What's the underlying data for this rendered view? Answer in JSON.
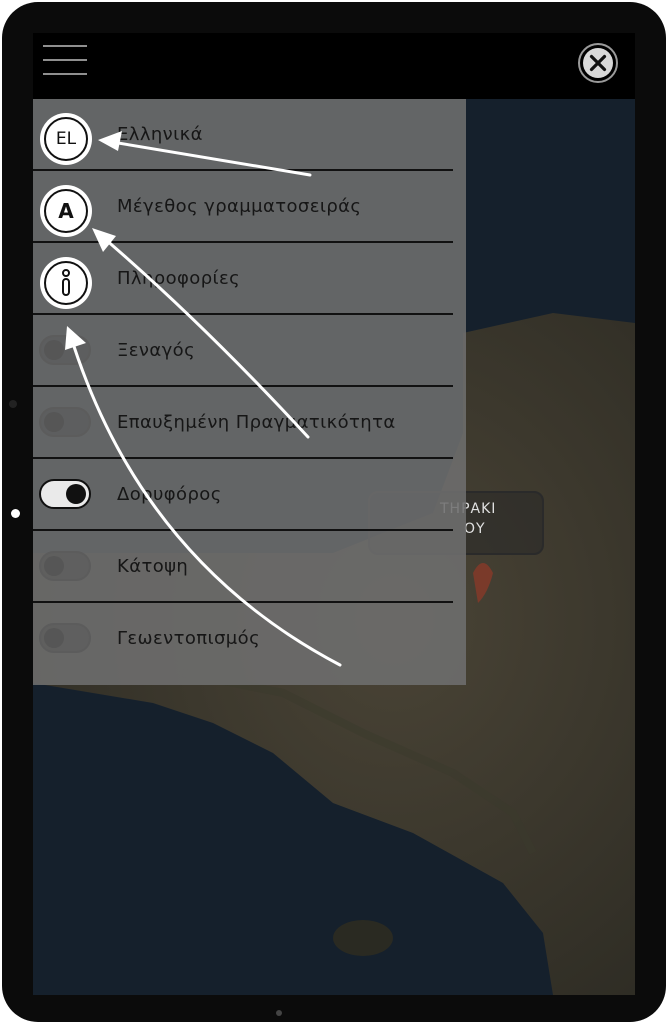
{
  "menu": {
    "items": [
      {
        "label": "Ελληνικά",
        "icon": "language-el-icon",
        "icon_text": "EL"
      },
      {
        "label": "Μέγεθος γραμματοσειράς",
        "icon": "font-size-icon",
        "icon_text": "A"
      },
      {
        "label": "Πληροφορίες",
        "icon": "info-icon"
      },
      {
        "label": "Ξεναγός",
        "toggle": false
      },
      {
        "label": "Επαυξημένη Πραγματικότητα",
        "toggle": false
      },
      {
        "label": "Δορυφόρος",
        "toggle": true
      },
      {
        "label": "Κάτοψη",
        "toggle": false
      },
      {
        "label": "Γεωεντοπισμός",
        "toggle": false
      }
    ]
  },
  "map": {
    "place_label_line1": "ΤΗΡΑΚΙ",
    "place_label_line2": "ΟΥ"
  },
  "icons": {
    "menu": "hamburger-icon",
    "close": "close-icon"
  },
  "colors": {
    "menu_bg": "#6e6e6e",
    "topbar_bg": "#000000",
    "toggle_on": "#111111",
    "annotation_arrow": "#ffffff"
  }
}
